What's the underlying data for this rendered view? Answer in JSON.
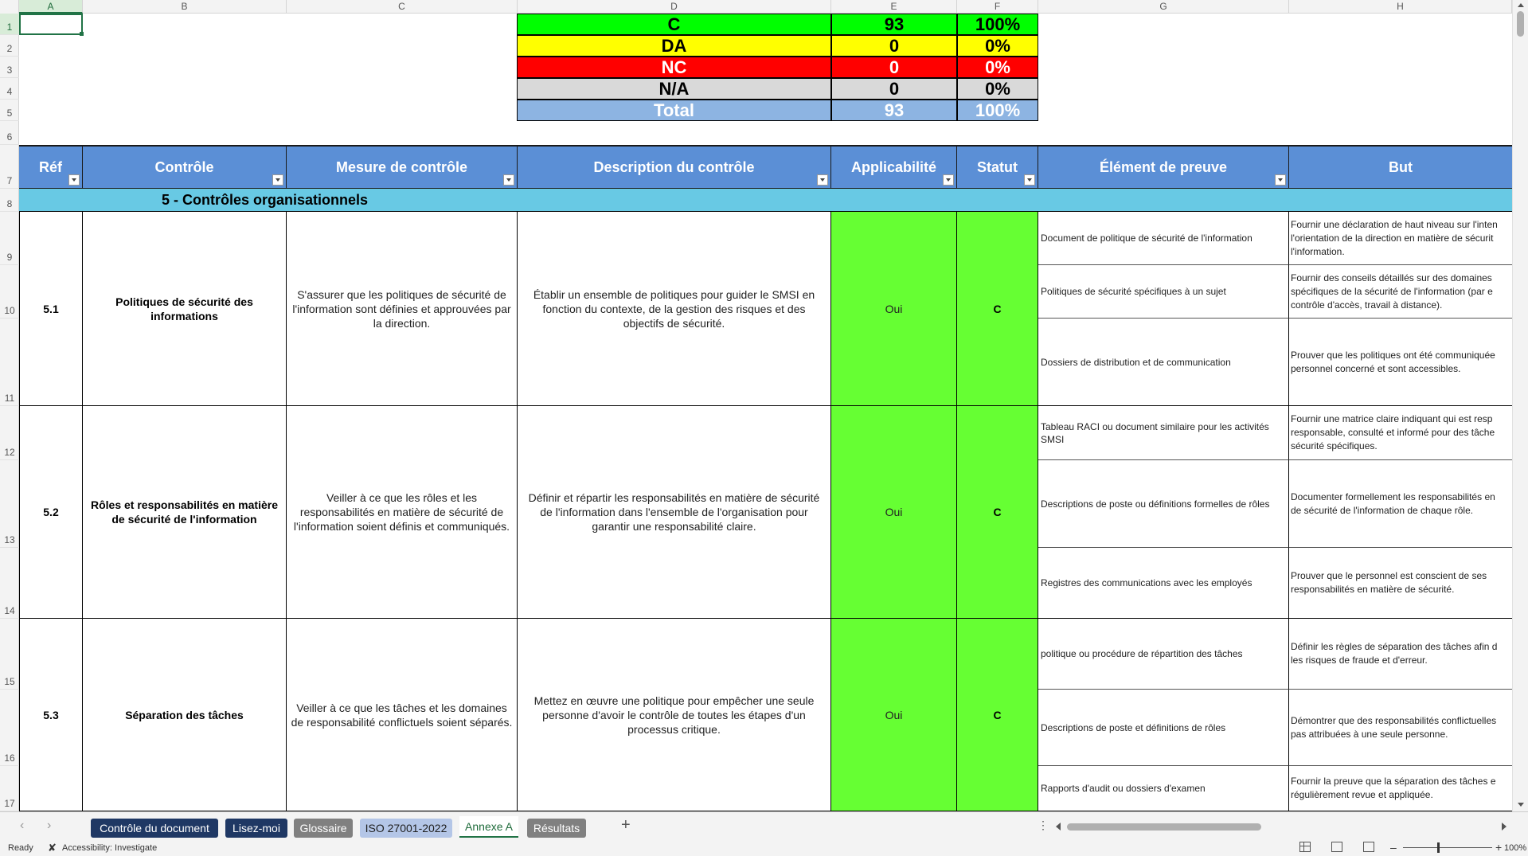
{
  "columns": [
    "A",
    "B",
    "C",
    "D",
    "E",
    "F",
    "G",
    "H"
  ],
  "rows": [
    "1",
    "2",
    "3",
    "4",
    "5",
    "6",
    "7",
    "8",
    "9",
    "10",
    "11",
    "12",
    "13",
    "14",
    "15",
    "16",
    "17"
  ],
  "summary": [
    {
      "label": "C",
      "count": "93",
      "pct": "100%",
      "bg": "#00ff00",
      "color": "#000000"
    },
    {
      "label": "DA",
      "count": "0",
      "pct": "0%",
      "bg": "#ffff00",
      "color": "#000000"
    },
    {
      "label": "NC",
      "count": "0",
      "pct": "0%",
      "bg": "#ff0000",
      "color": "#ffffff"
    },
    {
      "label": "N/A",
      "count": "0",
      "pct": "0%",
      "bg": "#d9d9d9",
      "color": "#000000"
    },
    {
      "label": "Total",
      "count": "93",
      "pct": "100%",
      "bg": "#8db4e2",
      "color": "#ffffff"
    }
  ],
  "headers": [
    "Réf",
    "Contrôle",
    "Mesure de contrôle",
    "Description du contrôle",
    "Applicabilité",
    "Statut",
    "Élément de preuve",
    "But"
  ],
  "section": "5 - Contrôles organisationnels",
  "controls": [
    {
      "ref": "5.1",
      "name": "Politiques de sécurité des informations",
      "measure": "S'assurer que les politiques de sécurité de l'information sont définies et approuvées par la direction.",
      "description": "Établir un ensemble de politiques pour guider le SMSI en fonction du contexte, de la gestion des risques et des objectifs de sécurité.",
      "applicability": "Oui",
      "status": "C",
      "evidence": [
        {
          "text": "Document de politique de sécurité de l'information",
          "but": [
            "Fournir une déclaration de haut niveau sur l'inten",
            "l'orientation de la direction en matière de sécurit",
            "l'information."
          ]
        },
        {
          "text": "Politiques de sécurité spécifiques à un sujet",
          "but": [
            "Fournir des conseils détaillés sur des domaines",
            "spécifiques de la sécurité de l'information (par e",
            "contrôle d'accès, travail à distance)."
          ]
        },
        {
          "text": "Dossiers de distribution et de communication",
          "but": [
            "Prouver que les politiques ont été communiquée",
            "personnel concerné et sont accessibles."
          ]
        }
      ]
    },
    {
      "ref": "5.2",
      "name": "Rôles et responsabilités en matière de sécurité de l'information",
      "measure": "Veiller à ce que les rôles et les responsabilités en matière de sécurité de l'information soient définis et communiqués.",
      "description": "Définir et répartir les responsabilités en matière de sécurité de l'information dans l'ensemble de l'organisation pour garantir une responsabilité claire.",
      "applicability": "Oui",
      "status": "C",
      "evidence": [
        {
          "text": "Tableau RACI ou document similaire pour les activités SMSI",
          "but": [
            "Fournir une matrice claire indiquant qui est resp",
            "responsable, consulté et informé pour des tâche",
            "sécurité spécifiques."
          ]
        },
        {
          "text": "Descriptions de poste ou définitions formelles de rôles",
          "but": [
            "Documenter formellement les responsabilités en",
            "de sécurité de l'information de chaque rôle."
          ]
        },
        {
          "text": "Registres des communications avec les employés",
          "but": [
            "Prouver que le personnel est conscient de ses",
            "responsabilités en matière de sécurité."
          ]
        }
      ]
    },
    {
      "ref": "5.3",
      "name": "Séparation des tâches",
      "measure": "Veiller à ce que les tâches et les domaines de responsabilité conflictuels soient séparés.",
      "description": "Mettez en œuvre une politique pour empêcher une seule personne d'avoir le contrôle de toutes les étapes d'un processus critique.",
      "applicability": "Oui",
      "status": "C",
      "evidence": [
        {
          "text": "politique ou procédure de répartition des tâches",
          "but": [
            "Définir les règles de séparation des tâches afin d",
            "les risques de fraude et d'erreur."
          ]
        },
        {
          "text": "Descriptions de poste et définitions de rôles",
          "but": [
            "Démontrer que des responsabilités conflictuelles",
            "pas attribuées à une seule personne."
          ]
        },
        {
          "text": "Rapports d'audit ou dossiers d'examen",
          "but": [
            "Fournir la preuve que la séparation des tâches e",
            "régulièrement revue et appliquée."
          ]
        }
      ]
    }
  ],
  "sheet_tabs": [
    {
      "label": "Contrôle du document",
      "bg": "#1f3864"
    },
    {
      "label": "Lisez-moi",
      "bg": "#1f3864"
    },
    {
      "label": "Glossaire",
      "bg": "#808080"
    },
    {
      "label": "ISO 27001-2022",
      "bg": "#b4c6e7"
    },
    {
      "label": "Annexe A",
      "bg": "#ffffff"
    },
    {
      "label": "Résultats",
      "bg": "#808080"
    }
  ],
  "status_bar": {
    "ready": "Ready",
    "accessibility": "Accessibility: Investigate",
    "zoom": "100%"
  }
}
